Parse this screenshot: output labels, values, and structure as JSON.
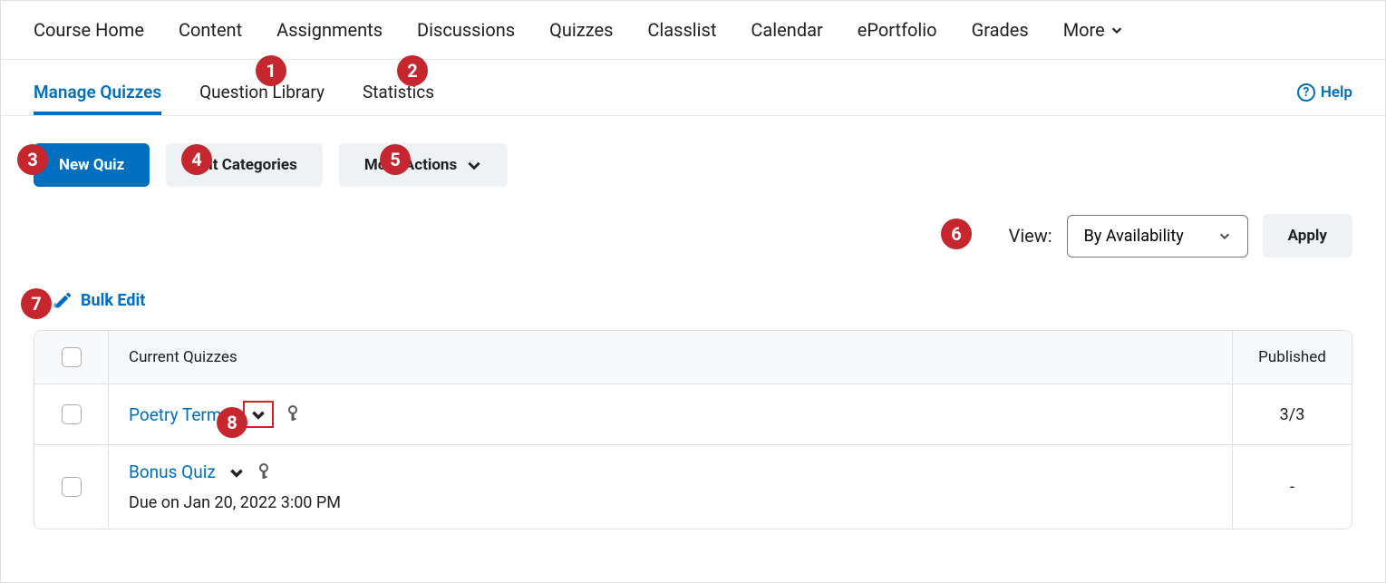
{
  "top_nav": {
    "items": [
      "Course Home",
      "Content",
      "Assignments",
      "Discussions",
      "Quizzes",
      "Classlist",
      "Calendar",
      "ePortfolio",
      "Grades"
    ],
    "more_label": "More"
  },
  "sub_nav": {
    "tabs": [
      "Manage Quizzes",
      "Question Library",
      "Statistics"
    ],
    "help_label": "Help"
  },
  "toolbar": {
    "new_quiz": "New Quiz",
    "edit_categories": "Edit Categories",
    "more_actions": "More Actions"
  },
  "view_filter": {
    "label": "View:",
    "selected": "By Availability",
    "apply": "Apply"
  },
  "bulk_edit": "Bulk Edit",
  "table": {
    "header_main": "Current Quizzes",
    "header_published": "Published",
    "rows": [
      {
        "title": "Poetry Terms",
        "due": "",
        "published": "3/3",
        "highlight_chevron": true
      },
      {
        "title": "Bonus Quiz",
        "due": "Due on Jan 20, 2022 3:00 PM",
        "published": "-",
        "highlight_chevron": false
      }
    ]
  },
  "annotations": [
    "1",
    "2",
    "3",
    "4",
    "5",
    "6",
    "7",
    "8"
  ]
}
